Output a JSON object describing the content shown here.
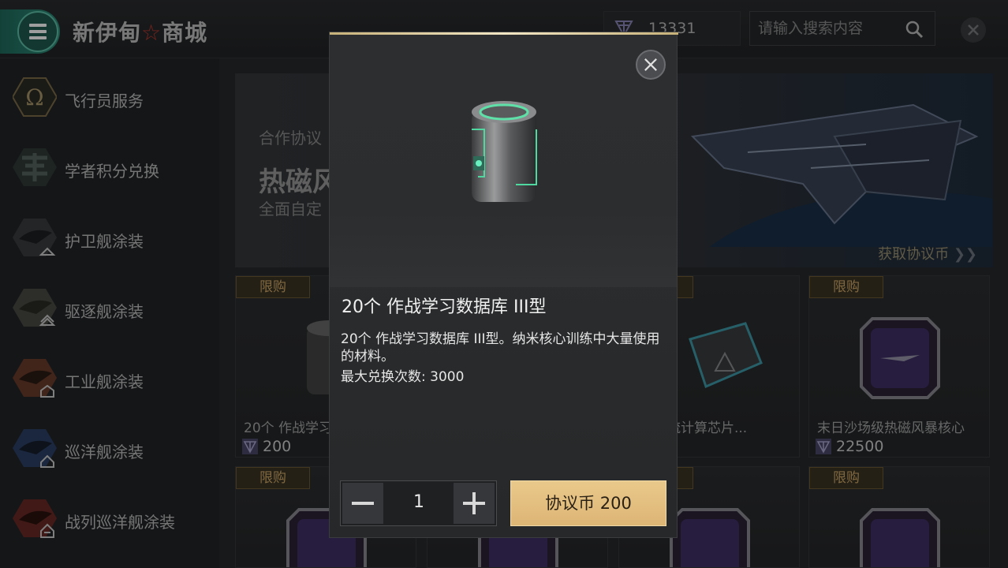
{
  "header": {
    "title_left": "新伊甸",
    "title_star": "☆",
    "title_right": "商城",
    "coin_balance": "13331",
    "search_placeholder": "请输入搜索内容"
  },
  "sidebar": {
    "items": [
      {
        "label": "飞行员服务"
      },
      {
        "label": "学者积分兑换"
      },
      {
        "label": "护卫舰涂装"
      },
      {
        "label": "驱逐舰涂装"
      },
      {
        "label": "工业舰涂装"
      },
      {
        "label": "巡洋舰涂装"
      },
      {
        "label": "战列巡洋舰涂装"
      }
    ]
  },
  "banner": {
    "subtitle": "合作协议",
    "title": "热磁风",
    "desc": "全面自定",
    "link": "获取协议币",
    "link_arrow": "❯❯"
  },
  "cards": [
    {
      "tag": "限购",
      "name": "20个 作战学习数据库 III型",
      "price": "200"
    },
    {
      "tag": "限购",
      "name": "战信息流计算芯片...",
      "price": ""
    },
    {
      "tag": "限购",
      "name": "末日沙场级热磁风暴核心",
      "price": "22500"
    },
    {
      "tag": "限购"
    },
    {
      "tag": "限购"
    },
    {
      "tag": "限购"
    }
  ],
  "modal": {
    "title": "20个 作战学习数据库 III型",
    "description": "20个 作战学习数据库 III型。纳米核心训练中大量使用的材料。",
    "limit": "最大兑换次数: 3000",
    "quantity": "1",
    "buy_label": "协议币 200"
  },
  "colors": {
    "accent_teal": "#2f8f7b",
    "gold_button": "#e2bd7d",
    "limit_tag": "#cfa968"
  }
}
